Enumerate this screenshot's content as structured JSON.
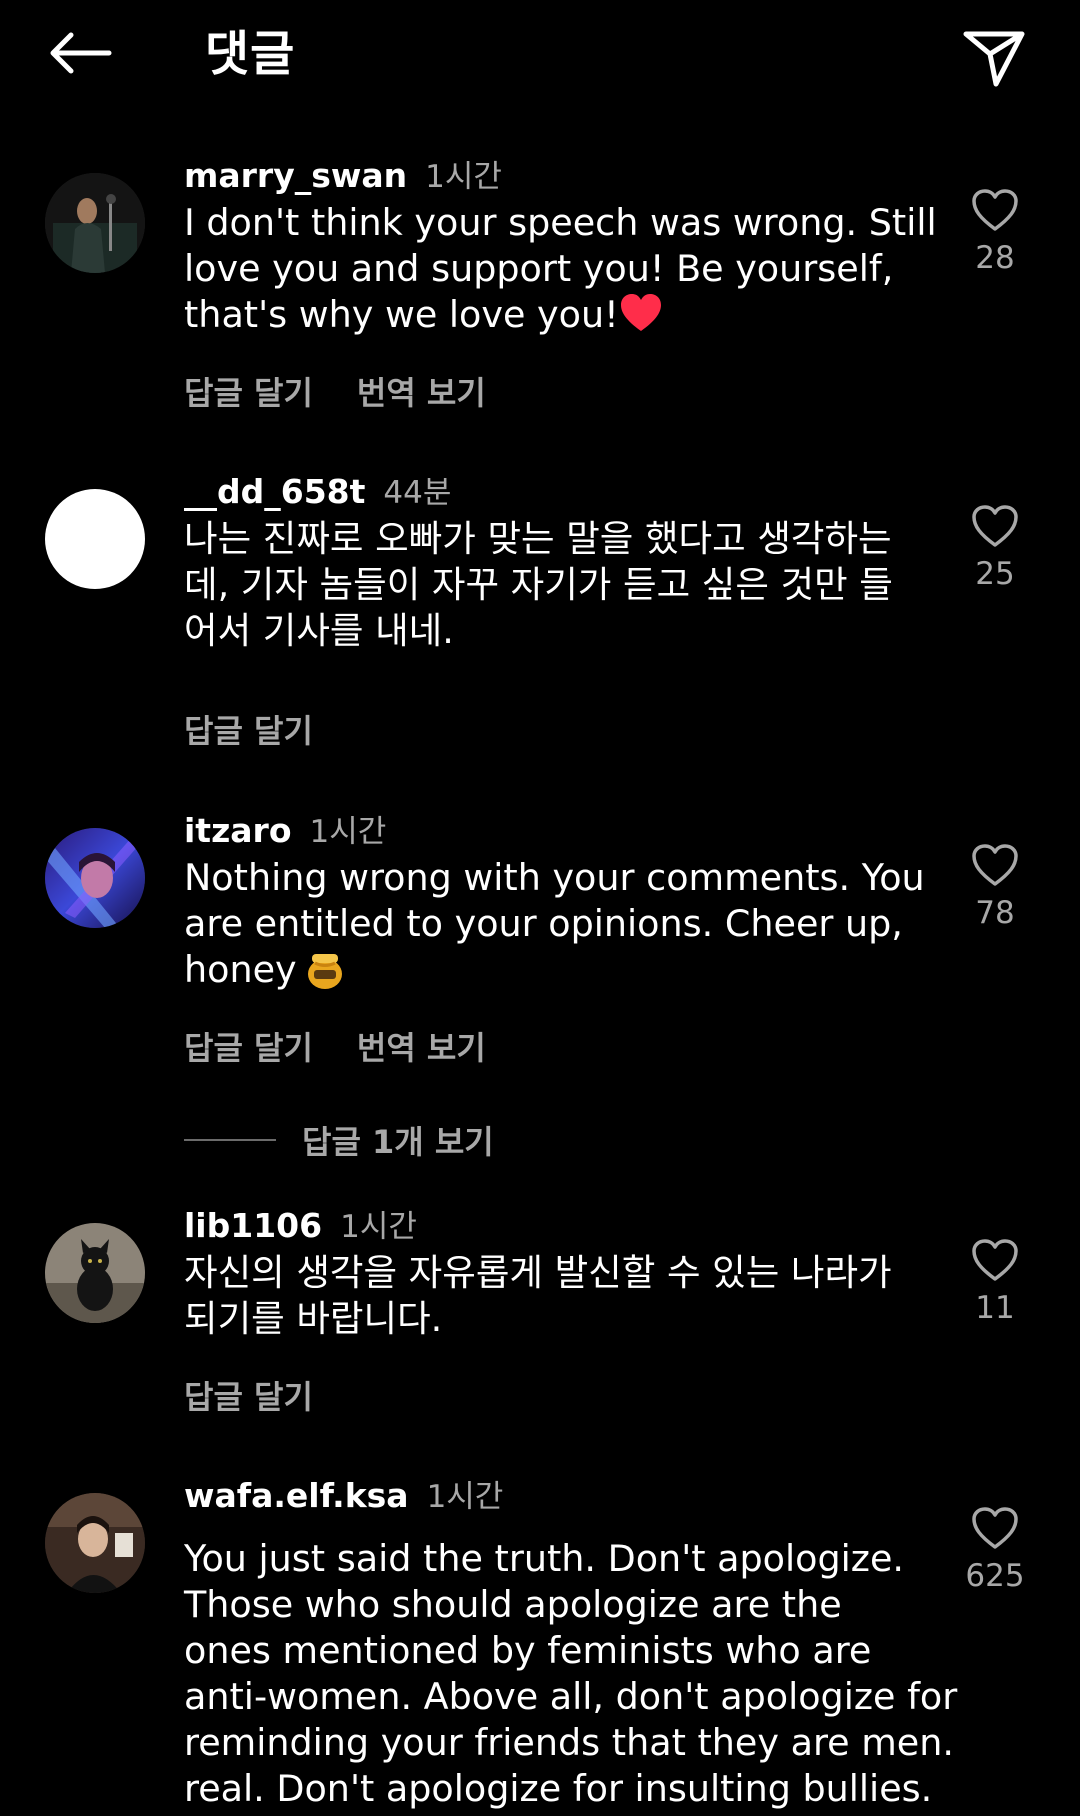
{
  "header": {
    "title": "댓글",
    "back_icon": "arrow-left-icon",
    "send_icon": "paper-plane-icon"
  },
  "comments": [
    {
      "username": "marry_swan",
      "time": "1시간",
      "lines": [
        "I don't think your speech was wrong. Still",
        "love you and support you! Be yourself,",
        "that's why we love you!"
      ],
      "trailing_emoji": "❤️",
      "reply_label": "답글 달기",
      "translate_label": "번역 보기",
      "likes": "28"
    },
    {
      "username": "__dd_658t",
      "time": "44분",
      "lines": [
        "나는 진짜로 오빠가 맞는 말을 했다고 생각하는",
        "데, 기자 놈들이 자꾸 자기가 듣고 싶은 것만 들",
        "어서 기사를 내네."
      ],
      "reply_label": "답글 달기",
      "likes": "25"
    },
    {
      "username": "itzaro",
      "time": "1시간",
      "lines": [
        "Nothing wrong with your comments. You",
        "are entitled to your opinions.  Cheer up,",
        "honey"
      ],
      "trailing_emoji": "🍯",
      "reply_label": "답글 달기",
      "translate_label": "번역 보기",
      "likes": "78",
      "view_replies_label": "답글 1개 보기"
    },
    {
      "username": "lib1106",
      "time": "1시간",
      "lines": [
        "자신의 생각을 자유롭게 발신할 수 있는 나라가",
        "되기를 바랍니다."
      ],
      "reply_label": "답글 달기",
      "likes": "11"
    },
    {
      "username": "wafa.elf.ksa",
      "time": "1시간",
      "lines": [
        "You just said the truth.  Don't apologize.",
        "Those who should apologize are the",
        "ones mentioned by feminists who are",
        "anti-women. Above all, don't apologize for",
        "reminding your friends that they are men.",
        "real.  Don't apologize for insulting bullies."
      ],
      "likes": "625"
    }
  ],
  "colors": {
    "background": "#000000",
    "text": "#ffffff",
    "secondary_text": "#a8a8a8",
    "emoji_heart": "#ff2d4a"
  }
}
